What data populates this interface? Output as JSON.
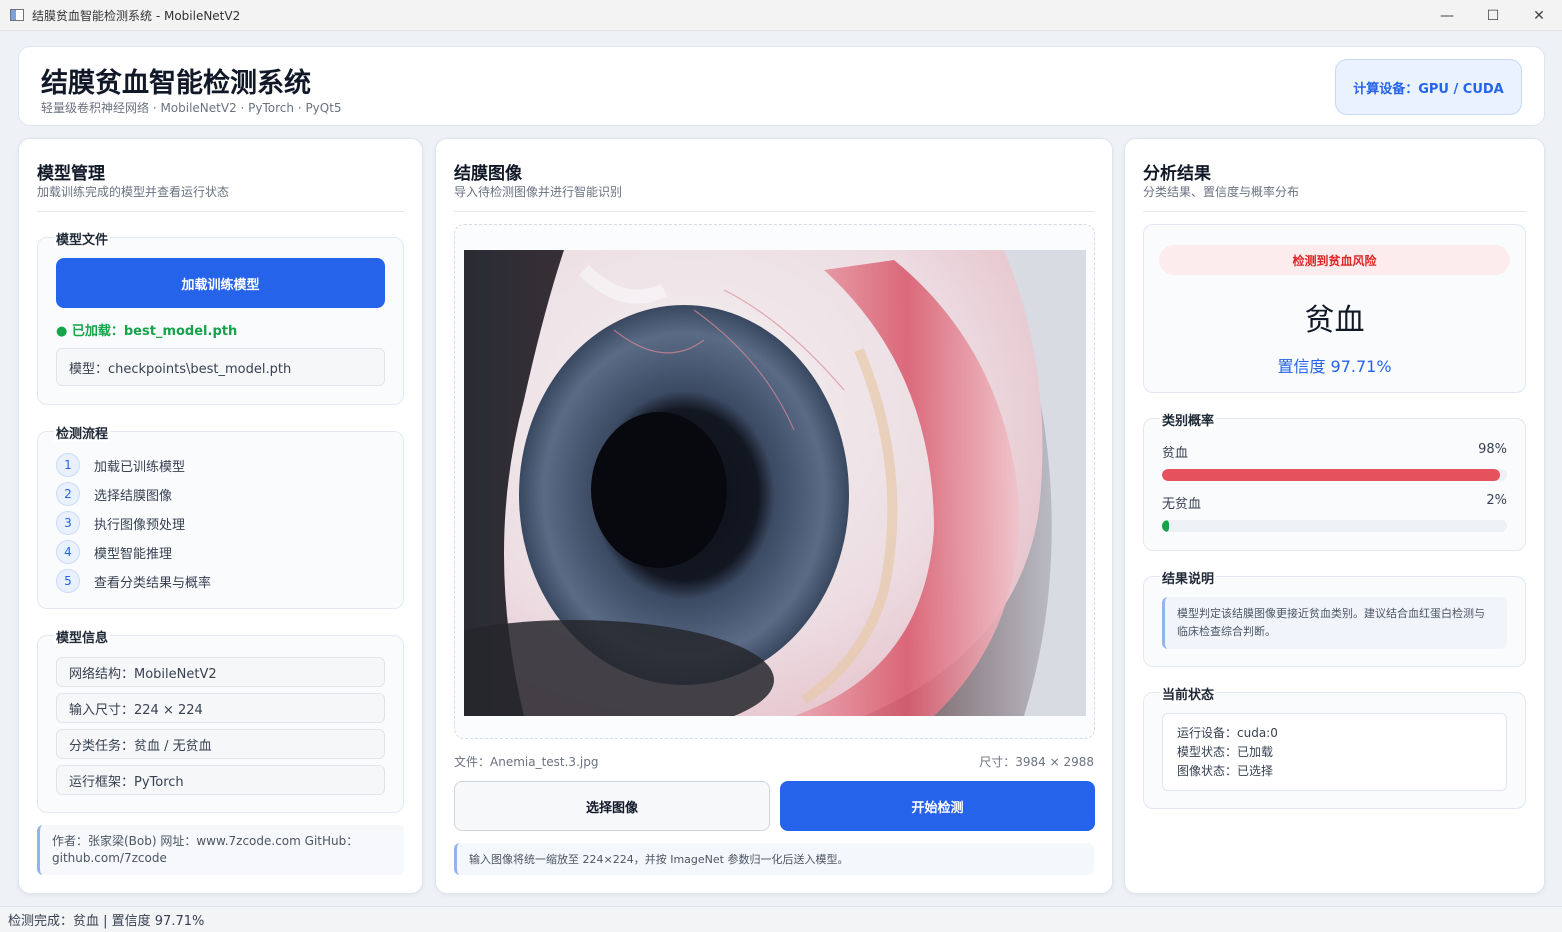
{
  "window": {
    "title": "结膜贫血智能检测系统 - MobileNetV2",
    "minimize": "—",
    "maximize": "☐",
    "close": "✕"
  },
  "header": {
    "title": "结膜贫血智能检测系统",
    "subtitle": "轻量级卷积神经网络 · MobileNetV2 · PyTorch · PyQt5",
    "device_badge": "计算设备：GPU / CUDA"
  },
  "left_panel": {
    "title": "模型管理",
    "subtitle": "加载训练完成的模型并查看运行状态",
    "model_file": {
      "title": "模型文件",
      "load_button": "加载训练模型",
      "loaded_status": "● 已加载：best_model.pth",
      "path_field": "模型：checkpoints\\best_model.pth"
    },
    "workflow": {
      "title": "检测流程",
      "steps": [
        {
          "num": "1",
          "label": "加载已训练模型"
        },
        {
          "num": "2",
          "label": "选择结膜图像"
        },
        {
          "num": "3",
          "label": "执行图像预处理"
        },
        {
          "num": "4",
          "label": "模型智能推理"
        },
        {
          "num": "5",
          "label": "查看分类结果与概率"
        }
      ]
    },
    "model_info": {
      "title": "模型信息",
      "items": [
        "网络结构：MobileNetV2",
        "输入尺寸：224 × 224",
        "分类任务：贫血 / 无贫血",
        "运行框架：PyTorch"
      ]
    },
    "author": "作者：张家梁(Bob)  网址：www.7zcode.com GitHub：github.com/7zcode"
  },
  "middle_panel": {
    "title": "结膜图像",
    "subtitle": "导入待检测图像并进行智能识别",
    "file_name": "文件：Anemia_test.3.jpg",
    "image_size": "尺寸：3984 × 2988",
    "select_button": "选择图像",
    "detect_button": "开始检测",
    "note": "输入图像将统一缩放至 224×224，并按 ImageNet 参数归一化后送入模型。"
  },
  "right_panel": {
    "title": "分析结果",
    "subtitle": "分类结果、置信度与概率分布",
    "risk_badge": "检测到贫血风险",
    "result_label": "贫血",
    "confidence": "置信度  97.71%",
    "probabilities": {
      "title": "类别概率",
      "items": [
        {
          "label": "贫血",
          "value_text": "98%",
          "value": 0.98,
          "color": "#e5525e"
        },
        {
          "label": "无贫血",
          "value_text": "2%",
          "value": 0.02,
          "color": "#16a34a"
        }
      ]
    },
    "explanation": {
      "title": "结果说明",
      "text": "模型判定该结膜图像更接近贫血类别。建议结合血红蛋白检测与临床检查综合判断。"
    },
    "current_status": {
      "title": "当前状态",
      "lines": [
        "运行设备：cuda:0",
        "模型状态：已加载",
        "图像状态：已选择"
      ]
    }
  },
  "statusbar": {
    "text": "检测完成：贫血  |  置信度 97.71%"
  },
  "colors": {
    "accent": "#2563eb",
    "anemia": "#e5525e",
    "normal": "#16a34a",
    "loaded": "#16a34a"
  }
}
